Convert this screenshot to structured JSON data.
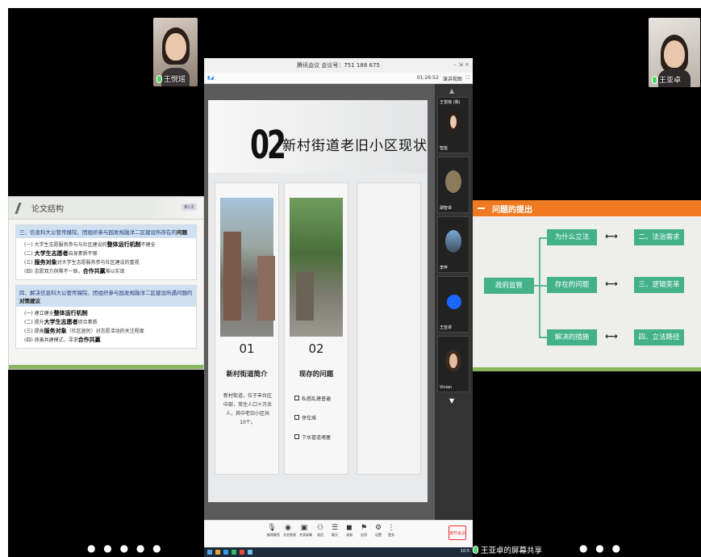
{
  "left_panel": {
    "camera_name": "王悦瑶",
    "slide": {
      "title": "论文结构",
      "tag": "第1页",
      "section3": {
        "heading_prefix": "三、信息科大公管传媒院、团组织参与园发规融洋二区建设所存在的",
        "heading_bold": "问题",
        "items": [
          {
            "pre": "(一) 大学生志愿服务参与与社区建设的",
            "bold": "整体运行机制",
            "post": "不健全"
          },
          {
            "pre": "(二) ",
            "bold": "大学生志愿者",
            "post": "自身素质不够"
          },
          {
            "pre": "(三) ",
            "bold": "服务对象",
            "post": "对大学生志愿服务参与社区建设的重视"
          },
          {
            "pre": "(四) 志愿双方供需不一致，",
            "bold": "合作共赢",
            "post": "难以实现"
          }
        ]
      },
      "section4": {
        "heading_prefix": "四、解决信息科大公管传媒院、团组织参与园发规融洋二区建设所遇问题的",
        "heading_bold": "对策建议",
        "items": [
          {
            "pre": "(一) 建立健全",
            "bold": "整体运行机制",
            "post": ""
          },
          {
            "pre": "(二) 提升",
            "bold": "大学生志愿者",
            "post": "综合素质"
          },
          {
            "pre": "(三) 提高",
            "bold": "服务对象",
            "post": "（社区居民）对志愿活动的关注程度"
          },
          {
            "pre": "(四) 改善共建模式，寻求",
            "bold": "合作共赢",
            "post": ""
          }
        ]
      }
    },
    "dots": "● ● ● ● ●"
  },
  "middle_panel": {
    "meeting_title": "腾讯会议 会议号：751 188 675",
    "time": "01:26:52",
    "toolbar_view": "演讲视图",
    "slide": {
      "number": "02",
      "title": "新村街道老旧小区现状",
      "card1": {
        "num": "01",
        "title": "新村街道简介",
        "body": "新村街道，位于丰台区中部，常住人口十万余人，其中老旧小区共10个。"
      },
      "card2": {
        "num": "02",
        "title": "现存的问题",
        "items": [
          "私搭乱建普遍",
          "停车难",
          "下水管道堵塞"
        ]
      }
    },
    "participants": [
      {
        "name": "王悦瑶 (我)",
        "tag": "智能"
      },
      {
        "name": "胡智卓",
        "tag": ""
      },
      {
        "name": "李梓",
        "tag": ""
      },
      {
        "name": "王亚卓",
        "tag": "王亚"
      },
      {
        "name": "Vivian",
        "tag": ""
      }
    ],
    "bottom_buttons": [
      "解除静音",
      "开启视频",
      "共享屏幕",
      "成员",
      "聊天",
      "录制",
      "应用",
      "设置",
      "更多"
    ],
    "end_button": "离开会议",
    "taskbar_time": "10:5"
  },
  "right_panel": {
    "camera_name": "王亚卓",
    "slide": {
      "header": "问题的提出",
      "root": "政府监管",
      "middle": [
        "为什么立法",
        "存在的问题",
        "解决的措施"
      ],
      "right": [
        "二、法治需求",
        "三、逻辑变革",
        "四、立法路径"
      ]
    },
    "dots": "● ● ●"
  },
  "share_status": "王亚卓的屏幕共享"
}
